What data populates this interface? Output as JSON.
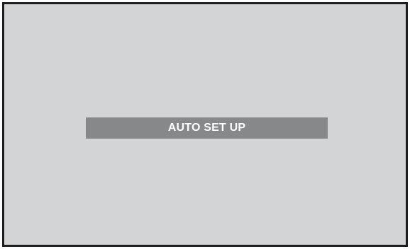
{
  "screen": {
    "background_color": "#d3d4d6",
    "border_color": "#1e1e1e"
  },
  "osd": {
    "message": "AUTO SET UP",
    "bar_color": "#87888a",
    "text_color": "#ffffff"
  }
}
